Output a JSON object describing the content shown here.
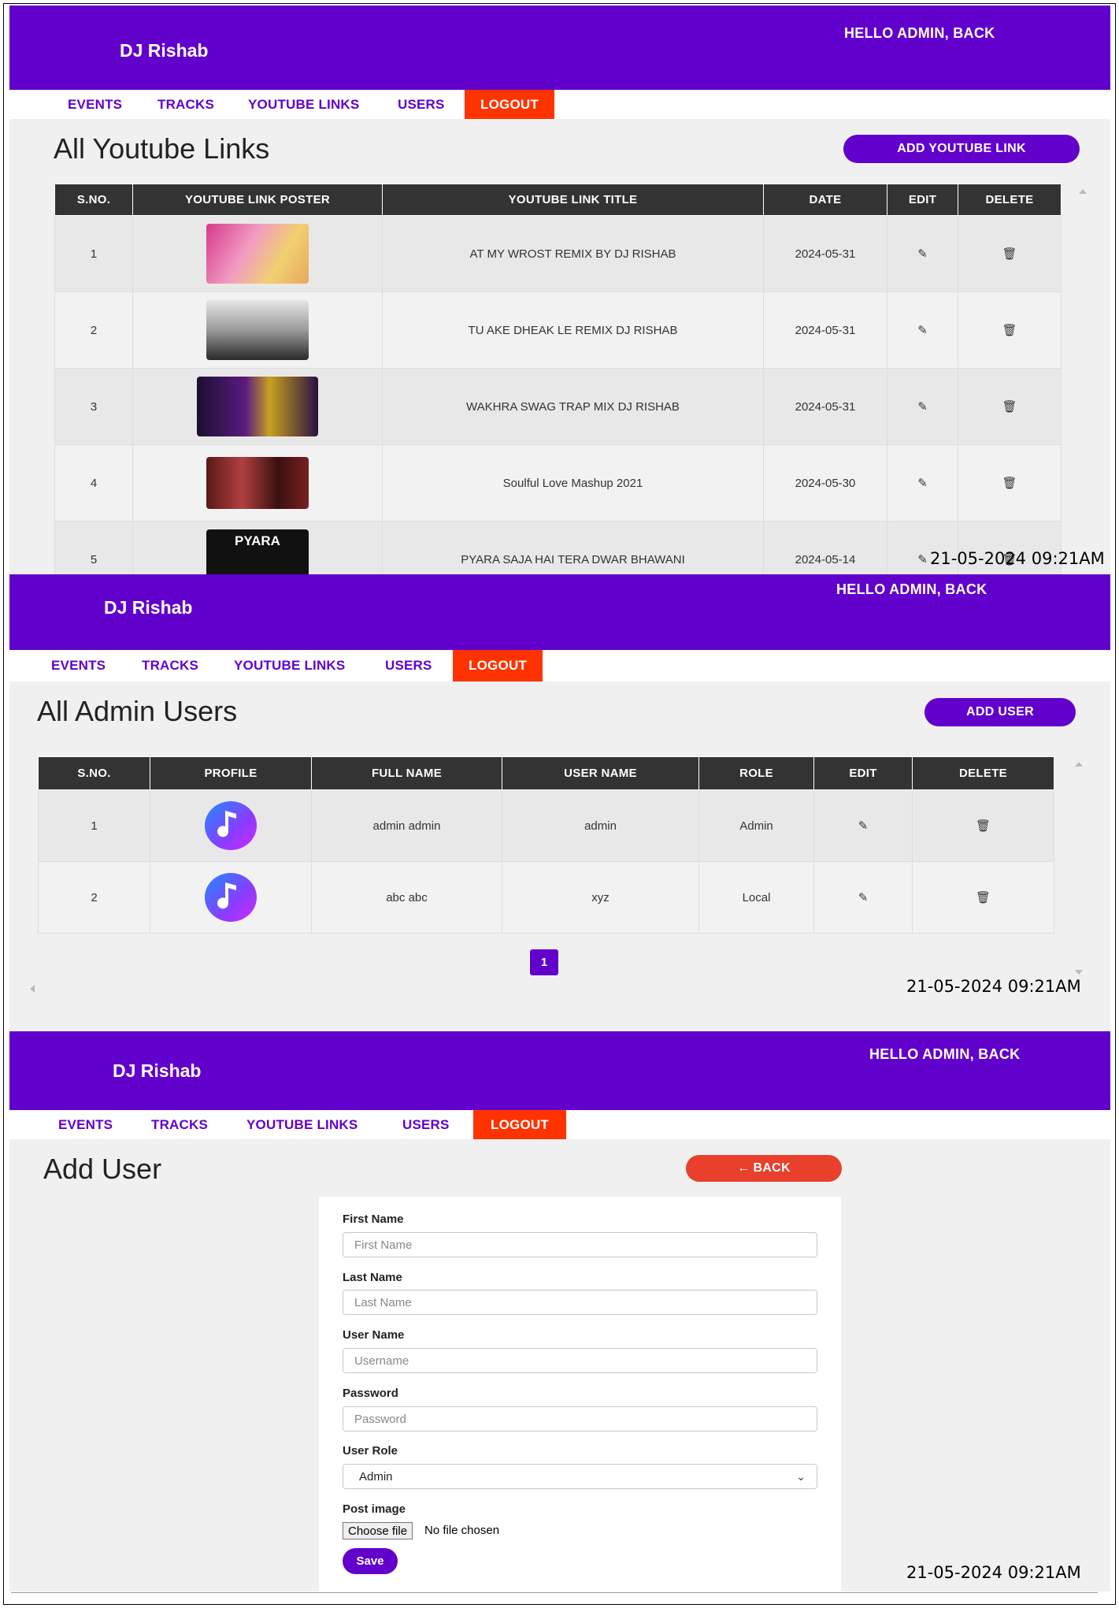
{
  "brand": "DJ Rishab",
  "greeting": "HELLO ADMIN, BACK",
  "nav": {
    "events": "EVENTS",
    "tracks": "TRACKS",
    "youtube_links": "YOUTUBE LINKS",
    "users": "USERS",
    "logout": "LOGOUT"
  },
  "timestamp": "21-05-2024 09:21AM",
  "colors": {
    "primary": "#6200cc",
    "logout": "#ff3300",
    "back": "#e8402c",
    "table_header": "#333333"
  },
  "youtube": {
    "title": "All Youtube Links",
    "add_button": "ADD YOUTUBE LINK",
    "headers": [
      "S.NO.",
      "YOUTUBE LINK POSTER",
      "YOUTUBE LINK TITLE",
      "DATE",
      "EDIT",
      "DELETE"
    ],
    "rows": [
      {
        "sno": "1",
        "title": "AT MY WROST REMIX BY DJ RISHAB",
        "date": "2024-05-31"
      },
      {
        "sno": "2",
        "title": "TU AKE DHEAK LE REMIX DJ RISHAB",
        "date": "2024-05-31"
      },
      {
        "sno": "3",
        "title": "WAKHRA SWAG TRAP MIX DJ RISHAB",
        "date": "2024-05-31"
      },
      {
        "sno": "4",
        "title": "Soulful Love Mashup 2021",
        "date": "2024-05-30"
      },
      {
        "sno": "5",
        "title": "PYARA SAJA HAI TERA DWAR BHAWANI",
        "date": "2024-05-14"
      }
    ],
    "poster_5_text": "PYARA"
  },
  "users": {
    "title": "All Admin Users",
    "add_button": "ADD USER",
    "headers": [
      "S.NO.",
      "PROFILE",
      "FULL NAME",
      "USER NAME",
      "ROLE",
      "EDIT",
      "DELETE"
    ],
    "rows": [
      {
        "sno": "1",
        "full_name": "admin admin",
        "user_name": "admin",
        "role": "Admin"
      },
      {
        "sno": "2",
        "full_name": "abc abc",
        "user_name": "xyz",
        "role": "Local"
      }
    ],
    "page": "1"
  },
  "add_user": {
    "title": "Add User",
    "back_button": "BACK",
    "fields": {
      "first_name": {
        "label": "First Name",
        "placeholder": "First Name"
      },
      "last_name": {
        "label": "Last Name",
        "placeholder": "Last Name"
      },
      "user_name": {
        "label": "User Name",
        "placeholder": "Username"
      },
      "password": {
        "label": "Password",
        "placeholder": "Password"
      },
      "user_role": {
        "label": "User Role",
        "value": "Admin"
      },
      "post_image": {
        "label": "Post image",
        "button": "Choose file",
        "status": "No file chosen"
      }
    },
    "save_button": "Save"
  }
}
